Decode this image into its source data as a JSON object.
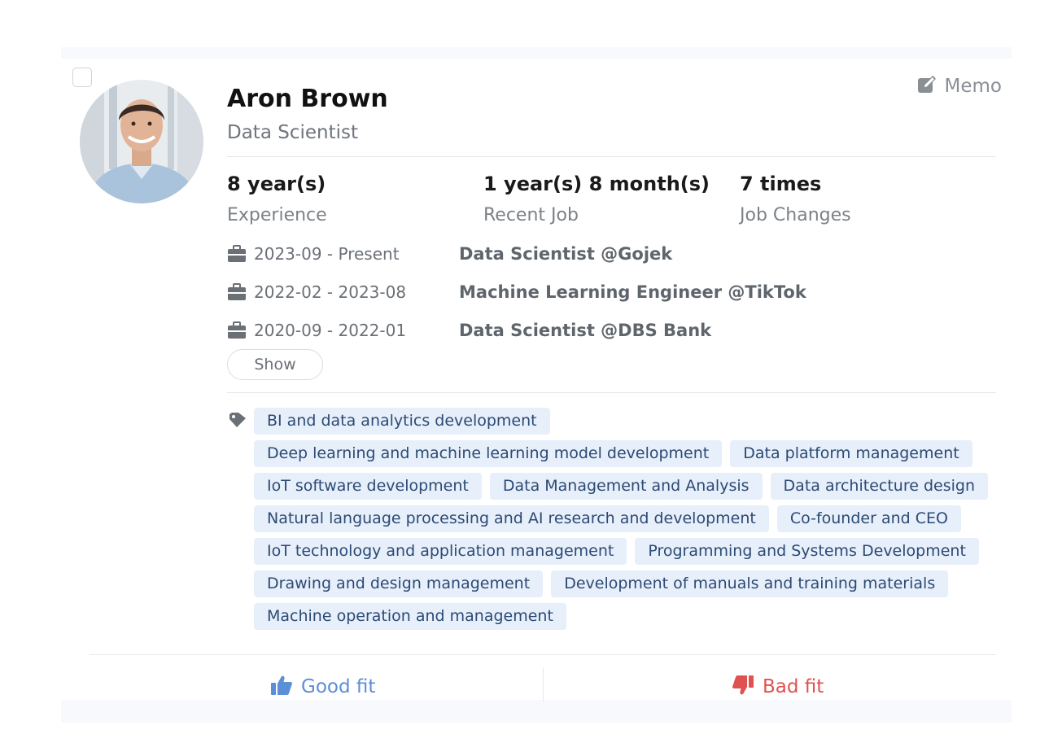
{
  "candidate": {
    "name": "Aron Brown",
    "title": "Data Scientist",
    "memo_label": "Memo"
  },
  "stats": [
    {
      "value": "8 year(s)",
      "label": "Experience"
    },
    {
      "value": "1 year(s) 8 month(s)",
      "label": "Recent Job"
    },
    {
      "value": "7 times",
      "label": "Job Changes"
    }
  ],
  "jobs": [
    {
      "period": "2023-09 - Present",
      "role": "Data Scientist @Gojek"
    },
    {
      "period": "2022-02 - 2023-08",
      "role": "Machine Learning Engineer @TikTok"
    },
    {
      "period": "2020-09 - 2022-01",
      "role": "Data Scientist @DBS Bank"
    }
  ],
  "show_label": "Show",
  "tags": [
    "BI and data analytics development",
    "Deep learning and machine learning model development",
    "Data platform management",
    "IoT software development",
    "Data Management and Analysis",
    "Data architecture design",
    "Natural language processing and AI research and development",
    "Co-founder and CEO",
    "IoT technology and application management",
    "Programming and Systems Development",
    "Drawing and design management",
    "Development of manuals and training materials",
    "Machine operation and management"
  ],
  "actions": {
    "good_fit": "Good fit",
    "bad_fit": "Bad fit"
  },
  "colors": {
    "good_fit": "#5b8fd6",
    "bad_fit": "#e0524f",
    "tag_bg": "#e7effb",
    "tag_text": "#2c4a73"
  },
  "icons": {
    "memo": "edit-icon",
    "job": "briefcase-icon",
    "tags": "tag-icon",
    "good_fit": "thumbs-up-icon",
    "bad_fit": "thumbs-down-icon"
  }
}
